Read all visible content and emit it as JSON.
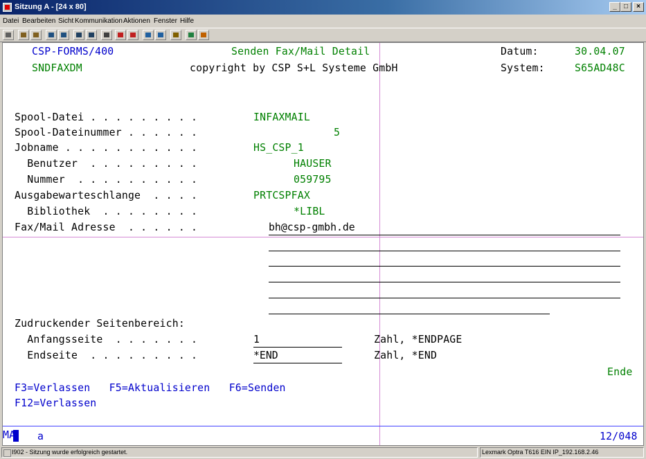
{
  "window": {
    "title": "Sitzung A - [24 x 80]"
  },
  "menu": [
    "Datei",
    "Bearbeiten",
    "Sicht",
    "Kommunikation",
    "Aktionen",
    "Fenster",
    "Hilfe"
  ],
  "toolbar_icons": [
    "display-icon",
    "copy-icon",
    "paste-icon",
    "send-icon",
    "receive-icon",
    "macro-icon",
    "record-icon",
    "play-icon",
    "print-icon",
    "print-screen-icon",
    "transfer-up-icon",
    "transfer-down-icon",
    "clipboard-icon",
    "globe-icon",
    "edit-icon"
  ],
  "header": {
    "app": "CSP-FORMS/400",
    "program": "SNDFAXDM",
    "title": "Senden Fax/Mail Detail",
    "copyright": "copyright by CSP S+L Systeme GmbH",
    "date_label": "Datum:",
    "date_value": "30.04.07",
    "system_label": "System:",
    "system_value": "S65AD48C"
  },
  "fields": [
    {
      "label": "Spool-Datei . . . . . . . . .",
      "value": "INFAXMAIL"
    },
    {
      "label": "Spool-Dateinummer . . . . . .",
      "value": "5"
    },
    {
      "label": "Jobname . . . . . . . . . . .",
      "value": "HS_CSP_1"
    },
    {
      "label": "  Benutzer  . . . . . . . . .",
      "value": "HAUSER"
    },
    {
      "label": "  Nummer  . . . . . . . . . .",
      "value": "059795"
    },
    {
      "label": "Ausgabewarteschlange  . . . .",
      "value": "PRTCSPFAX"
    },
    {
      "label": "  Bibliothek  . . . . . . . .",
      "value": "*LIBL"
    }
  ],
  "address": {
    "label": "Fax/Mail Adresse  . . . . . .",
    "value": "bh@csp-gmbh.de"
  },
  "page_range": {
    "heading": "Zudruckender Seitenbereich:",
    "start_label": "  Anfangsseite  . . . . . . .",
    "start_value": "1",
    "start_hint": "Zahl, *ENDPAGE",
    "end_label": "  Endseite  . . . . . . . . .",
    "end_value": "*END",
    "end_hint": "Zahl, *END"
  },
  "more_indicator": "Ende",
  "fkeys": {
    "line1": "F3=Verlassen   F5=Aktualisieren   F6=Senden",
    "line2": "F12=Verlassen"
  },
  "oia": {
    "ma": "MA",
    "input": "a",
    "cursor_pos": "12/048"
  },
  "status": {
    "message": "I902 - Sitzung wurde erfolgreich gestartet.",
    "printer": "Lexmark Optra T616 EIN IP_192.168.2.46"
  },
  "colors": {
    "screen_blue": "#0000cc",
    "screen_green": "#008000",
    "crosshair": "#d58ad5",
    "titlebar": "#0a246a"
  }
}
